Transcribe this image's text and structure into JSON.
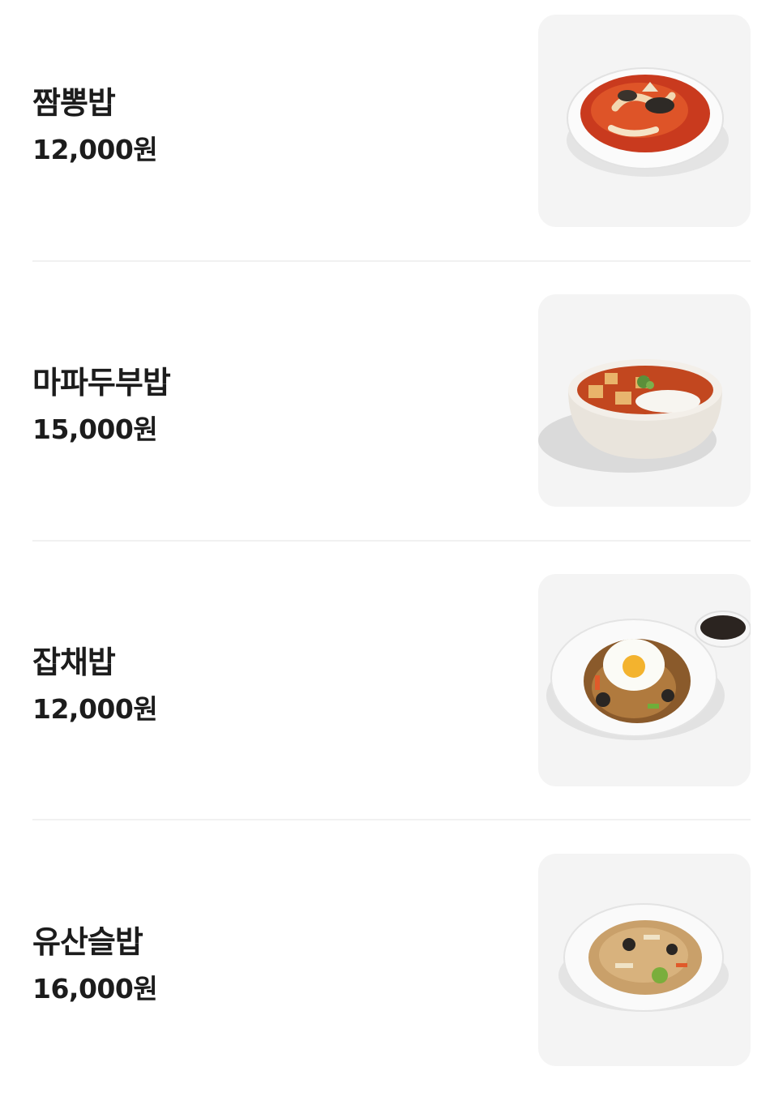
{
  "menu": {
    "items": [
      {
        "name": "짬뽕밥",
        "price": "12,000원",
        "image_icon": "jjamppong-bowl-photo"
      },
      {
        "name": "마파두부밥",
        "price": "15,000원",
        "image_icon": "mapo-tofu-rice-bowl-photo"
      },
      {
        "name": "잡채밥",
        "price": "12,000원",
        "image_icon": "japchae-rice-plate-photo"
      },
      {
        "name": "유산슬밥",
        "price": "16,000원",
        "image_icon": "yusanseul-rice-plate-photo"
      }
    ]
  },
  "colors": {
    "background": "#ffffff",
    "text": "#1c1c1c",
    "thumb_bg": "#f4f4f4",
    "divider": "#f1f1f1"
  }
}
